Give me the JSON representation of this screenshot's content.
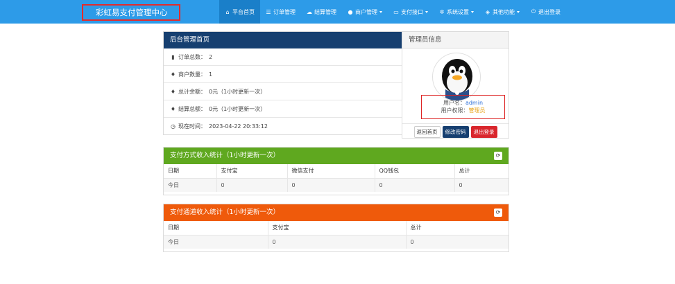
{
  "brand": "彩虹易支付管理中心",
  "nav": [
    {
      "icon": "home-icon",
      "glyph": "⌂",
      "label": "平台首页",
      "active": true,
      "dropdown": false
    },
    {
      "icon": "list-icon",
      "glyph": "☰",
      "label": "订单管理",
      "active": false,
      "dropdown": false
    },
    {
      "icon": "cloud-icon",
      "glyph": "☁",
      "label": "结算管理",
      "active": false,
      "dropdown": false
    },
    {
      "icon": "user-icon",
      "glyph": "●",
      "label": "商户管理",
      "active": false,
      "dropdown": true
    },
    {
      "icon": "credit-card-icon",
      "glyph": "▭",
      "label": "支付接口",
      "active": false,
      "dropdown": true
    },
    {
      "icon": "cog-icon",
      "glyph": "✲",
      "label": "系统设置",
      "active": false,
      "dropdown": true
    },
    {
      "icon": "cube-icon",
      "glyph": "◈",
      "label": "其他功能",
      "active": false,
      "dropdown": true
    },
    {
      "icon": "power-icon",
      "glyph": "⏻",
      "label": "退出登录",
      "active": false,
      "dropdown": false
    }
  ],
  "dashboard": {
    "title": "后台管理首页",
    "rows": [
      {
        "icon": "bar-chart-icon",
        "glyph": "▮",
        "label": "订单总数：",
        "value": "2"
      },
      {
        "icon": "tint-icon",
        "glyph": "♦",
        "label": "商户数量：",
        "value": "1"
      },
      {
        "icon": "tint-icon",
        "glyph": "♦",
        "label": "总计余额：",
        "value": "0元（1小时更新一次）"
      },
      {
        "icon": "tint-icon",
        "glyph": "♦",
        "label": "结算总额：",
        "value": "0元（1小时更新一次）"
      },
      {
        "icon": "clock-icon",
        "glyph": "◷",
        "label": "现在时间：",
        "value": "2023-04-22 20:33:12"
      }
    ]
  },
  "admin": {
    "title": "管理员信息",
    "username_label": "用户名：",
    "username": "admin",
    "role_label": "用户权限：",
    "role": "管理员",
    "buttons": {
      "home": "返回首页",
      "password": "修改密码",
      "logout": "退出登录"
    }
  },
  "pay_type_stats": {
    "title": "支付方式收入统计（1小时更新一次）",
    "headers": [
      "日期",
      "支付宝",
      "微信支付",
      "QQ钱包",
      "总计"
    ],
    "row": [
      "今日",
      "0",
      "0",
      "0",
      "0"
    ]
  },
  "channel_stats": {
    "title": "支付通道收入统计（1小时更新一次）",
    "headers": [
      "日期",
      "支付宝",
      "总计"
    ],
    "row": [
      "今日",
      "0",
      "0"
    ]
  },
  "colors": {
    "navbar": "#2d9be8",
    "dashboard_head": "#163f70",
    "green_head": "#5fa81f",
    "orange_head": "#ef5a0b"
  }
}
